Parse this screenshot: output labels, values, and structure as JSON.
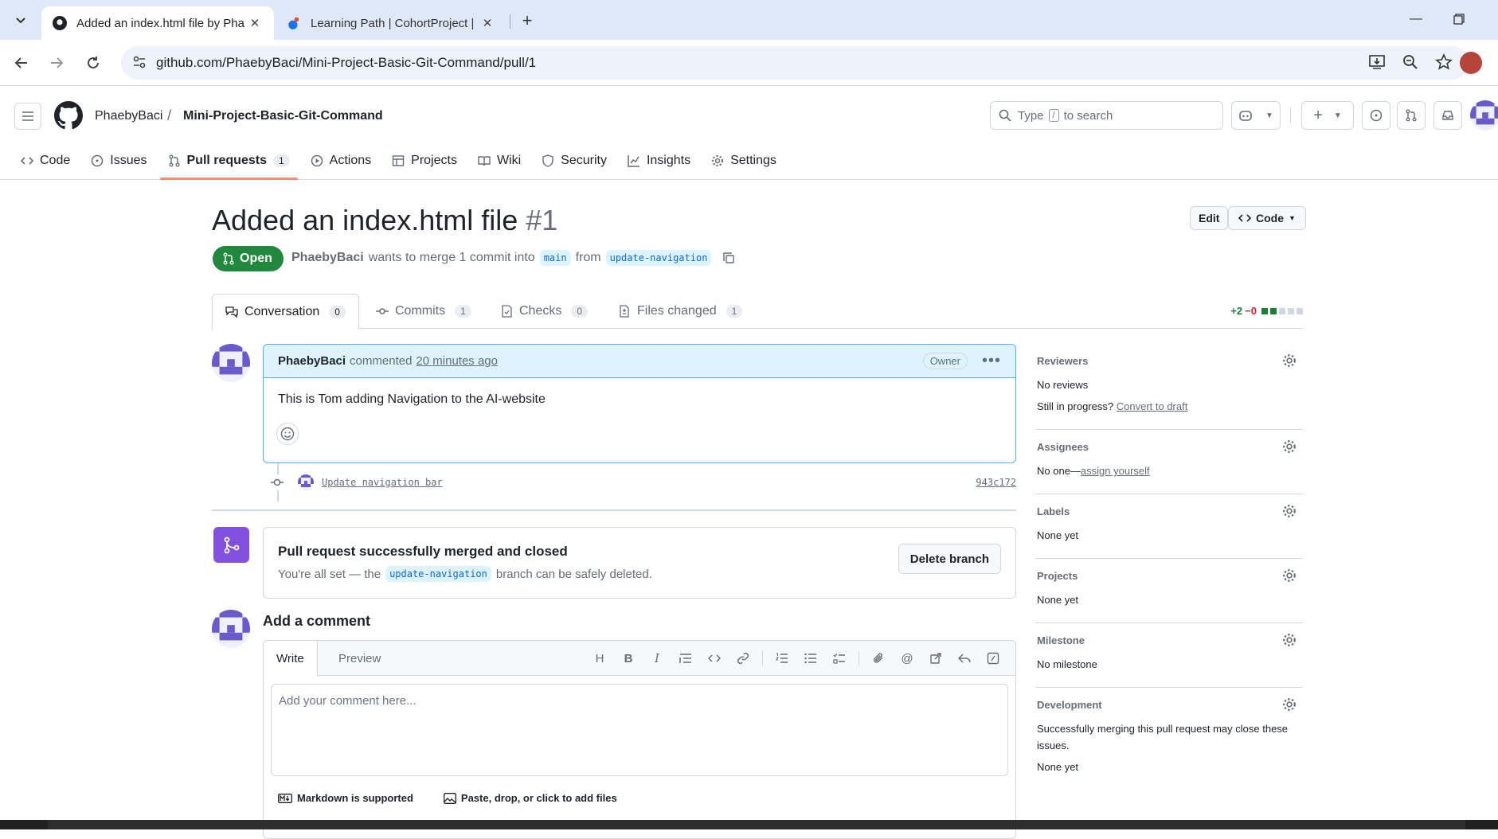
{
  "browser": {
    "tabs": [
      {
        "title": "Added an index.html file by Pha",
        "active": true
      },
      {
        "title": "Learning Path | CohortProject |",
        "active": false
      }
    ],
    "url": "github.com/PhaebyBaci/Mini-Project-Basic-Git-Command/pull/1"
  },
  "header": {
    "owner": "PhaebyBaci",
    "separator": "/",
    "repo": "Mini-Project-Basic-Git-Command",
    "search_prefix": "Type",
    "search_key": "/",
    "search_suffix": "to search"
  },
  "repo_nav": [
    {
      "label": "Code",
      "icon": "code-icon"
    },
    {
      "label": "Issues",
      "icon": "issue-icon"
    },
    {
      "label": "Pull requests",
      "icon": "pull-request-icon",
      "counter": "1",
      "active": true
    },
    {
      "label": "Actions",
      "icon": "play-icon"
    },
    {
      "label": "Projects",
      "icon": "table-icon"
    },
    {
      "label": "Wiki",
      "icon": "book-icon"
    },
    {
      "label": "Security",
      "icon": "shield-icon"
    },
    {
      "label": "Insights",
      "icon": "graph-icon"
    },
    {
      "label": "Settings",
      "icon": "gear-icon"
    }
  ],
  "pr": {
    "title": "Added an index.html file",
    "number": "#1",
    "edit_label": "Edit",
    "code_label": "Code",
    "state": "Open",
    "author": "PhaebyBaci",
    "merge_text": "wants to merge 1 commit into",
    "base": "main",
    "from_text": "from",
    "head": "update-navigation"
  },
  "pr_tabs": [
    {
      "label": "Conversation",
      "counter": "0",
      "active": true
    },
    {
      "label": "Commits",
      "counter": "1"
    },
    {
      "label": "Checks",
      "counter": "0"
    },
    {
      "label": "Files changed",
      "counter": "1"
    }
  ],
  "diffstat": {
    "additions": "+2",
    "deletions": "−0",
    "colors": [
      "#1a7f37",
      "#1a7f37",
      "#d0d7de",
      "#d0d7de",
      "#d0d7de"
    ]
  },
  "comment": {
    "author": "PhaebyBaci",
    "action": "commented",
    "time": "20 minutes ago",
    "badge": "Owner",
    "body": "This is Tom adding Navigation to the AI-website"
  },
  "commit": {
    "message": "Update navigation bar",
    "sha": "943c172"
  },
  "merged": {
    "title": "Pull request successfully merged and closed",
    "prefix": "You're all set — the",
    "branch": "update-navigation",
    "suffix": "branch can be safely deleted.",
    "button": "Delete branch"
  },
  "new_comment": {
    "heading": "Add a comment",
    "tab_write": "Write",
    "tab_preview": "Preview",
    "placeholder": "Add your comment here...",
    "markdown_note": "Markdown is supported",
    "files_note": "Paste, drop, or click to add files"
  },
  "sidebar": {
    "reviewers": {
      "title": "Reviewers",
      "line1": "No reviews",
      "line2_prefix": "Still in progress?",
      "line2_link": "Convert to draft"
    },
    "assignees": {
      "title": "Assignees",
      "prefix": "No one—",
      "link": "assign yourself"
    },
    "labels": {
      "title": "Labels",
      "value": "None yet"
    },
    "projects": {
      "title": "Projects",
      "value": "None yet"
    },
    "milestone": {
      "title": "Milestone",
      "value": "No milestone"
    },
    "development": {
      "title": "Development",
      "desc": "Successfully merging this pull request may close these issues.",
      "value": "None yet"
    }
  }
}
